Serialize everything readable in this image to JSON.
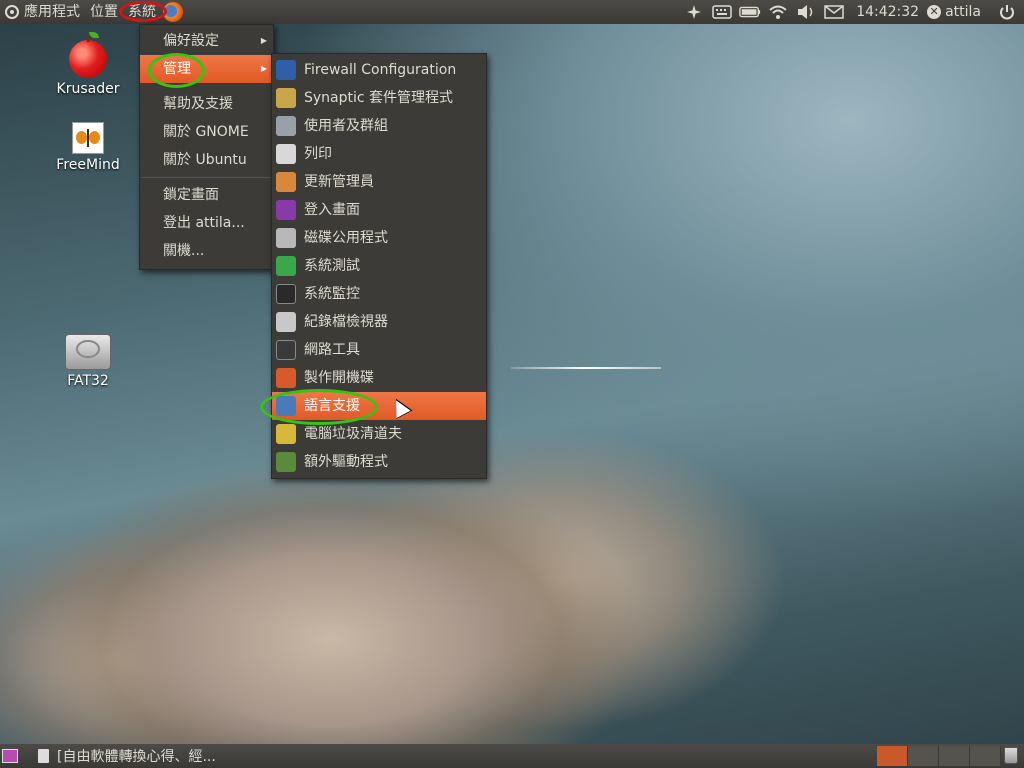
{
  "top_panel": {
    "menus": [
      "應用程式",
      "位置",
      "系統"
    ],
    "clock": "14:42:32",
    "username": "attila",
    "indicators": [
      "network-manager-icon",
      "keyboard-icon",
      "battery-icon",
      "wifi-icon",
      "volume-icon",
      "mail-icon"
    ]
  },
  "desktop_icons": [
    {
      "label": "Krusader",
      "icon": "apple-icon"
    },
    {
      "label": "FreeMind",
      "icon": "butterfly-icon"
    },
    {
      "label": "FAT32",
      "icon": "hard-drive-icon"
    }
  ],
  "system_menu": {
    "items": [
      "偏好設定",
      "管理",
      "幫助及支援",
      "關於 GNOME",
      "關於 Ubuntu",
      "鎖定畫面",
      "登出 attila...",
      "關機..."
    ],
    "highlighted": "管理"
  },
  "admin_menu": {
    "items": [
      {
        "label": "Firewall Configuration",
        "icon": "firewall-shield-icon",
        "color": "#2f5fa8"
      },
      {
        "label": "Synaptic 套件管理程式",
        "icon": "synaptic-package-icon",
        "color": "#c9a64a"
      },
      {
        "label": "使用者及群組",
        "icon": "users-groups-icon",
        "color": "#9aa0a8"
      },
      {
        "label": "列印",
        "icon": "printer-icon",
        "color": "#d8d8d8"
      },
      {
        "label": "更新管理員",
        "icon": "update-manager-icon",
        "color": "#d8883a"
      },
      {
        "label": "登入畫面",
        "icon": "login-screen-icon",
        "color": "#8a3aa8"
      },
      {
        "label": "磁碟公用程式",
        "icon": "disk-utility-icon",
        "color": "#b8b8b8"
      },
      {
        "label": "系統測試",
        "icon": "system-test-icon",
        "color": "#3aa84a"
      },
      {
        "label": "系統監控",
        "icon": "system-monitor-icon",
        "color": "#2a2a2a"
      },
      {
        "label": "紀錄檔檢視器",
        "icon": "log-viewer-icon",
        "color": "#c8c8c8"
      },
      {
        "label": "網路工具",
        "icon": "network-tools-icon",
        "color": "#3a3a3a"
      },
      {
        "label": "製作開機碟",
        "icon": "startup-disk-icon",
        "color": "#d85a2a"
      },
      {
        "label": "語言支援",
        "icon": "language-support-icon",
        "color": "#4a7ab8"
      },
      {
        "label": "電腦垃圾清道夫",
        "icon": "broom-icon",
        "color": "#d8b83a"
      },
      {
        "label": "額外驅動程式",
        "icon": "additional-drivers-icon",
        "color": "#5a8a3a"
      }
    ],
    "highlighted": "語言支援"
  },
  "bottom_panel": {
    "task_title": "[自由軟體轉換心得、經...",
    "workspaces": 4,
    "active_workspace": 1
  },
  "colors": {
    "panel": "#3c3b37",
    "highlight": "#e86a33",
    "annotation_green": "#33c414",
    "annotation_red": "#d3141a"
  }
}
